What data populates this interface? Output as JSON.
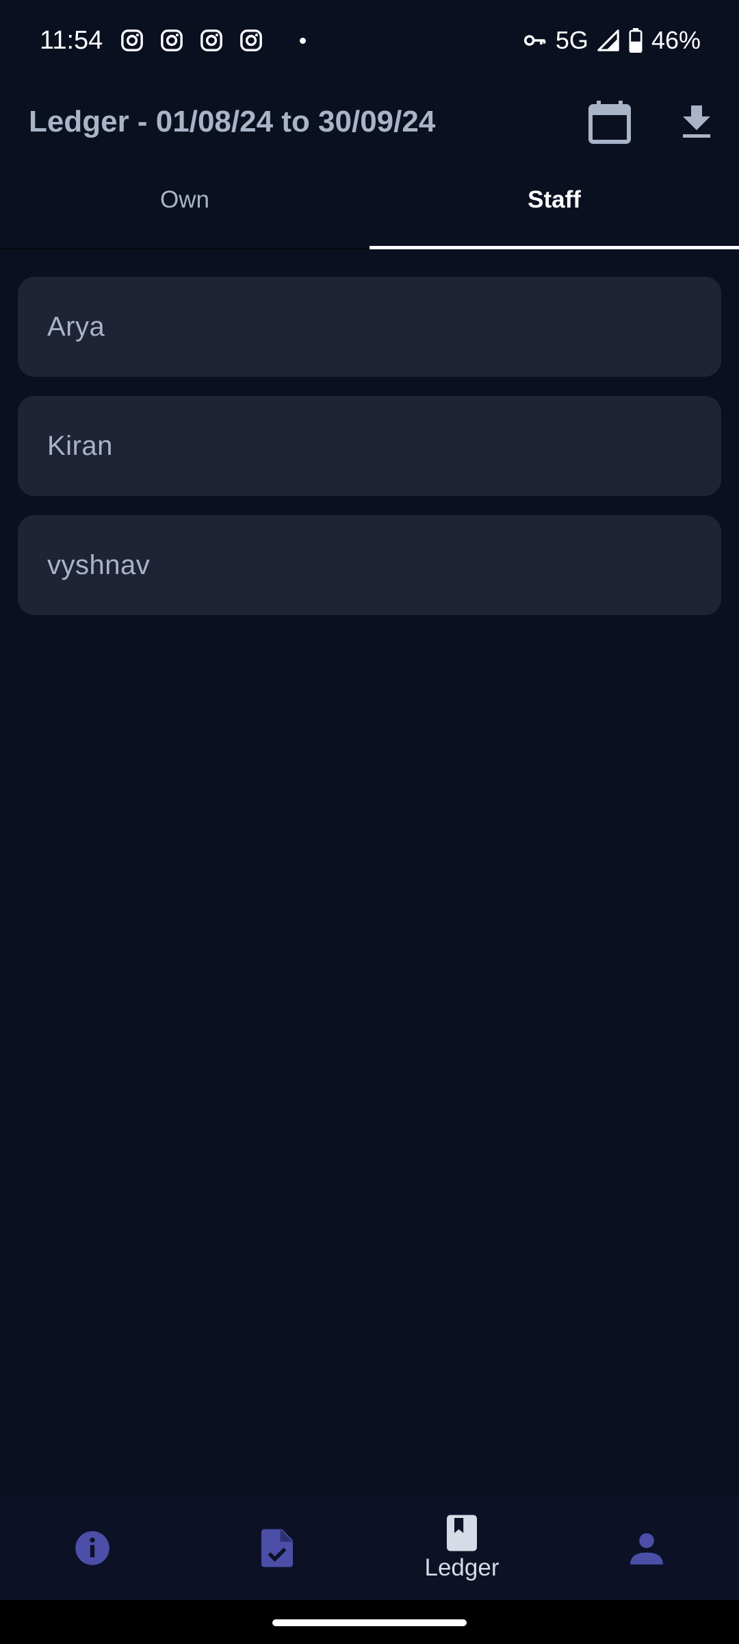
{
  "status_bar": {
    "time": "11:54",
    "network": "5G",
    "battery": "46%",
    "notification_icons": [
      "instagram-icon",
      "instagram-icon",
      "instagram-icon",
      "instagram-icon"
    ],
    "icons": [
      "vpn-key-icon",
      "signal-icon",
      "battery-icon"
    ]
  },
  "app_bar": {
    "title": "Ledger - 01/08/24 to 30/09/24",
    "actions": [
      "calendar-icon",
      "download-icon"
    ]
  },
  "tabs": [
    {
      "label": "Own",
      "active": false
    },
    {
      "label": "Staff",
      "active": true
    }
  ],
  "staff_list": [
    {
      "name": "Arya"
    },
    {
      "name": "Kiran"
    },
    {
      "name": "vyshnav"
    }
  ],
  "bottom_nav": {
    "items": [
      {
        "icon": "info-icon",
        "label": ""
      },
      {
        "icon": "task-document-icon",
        "label": ""
      },
      {
        "icon": "ledger-book-icon",
        "label": "Ledger",
        "active": true
      },
      {
        "icon": "person-icon",
        "label": ""
      }
    ]
  },
  "colors": {
    "background": "#0b1020",
    "card": "#1f2336",
    "accent": "#4b4fa8",
    "text_muted": "#aab4c8"
  }
}
